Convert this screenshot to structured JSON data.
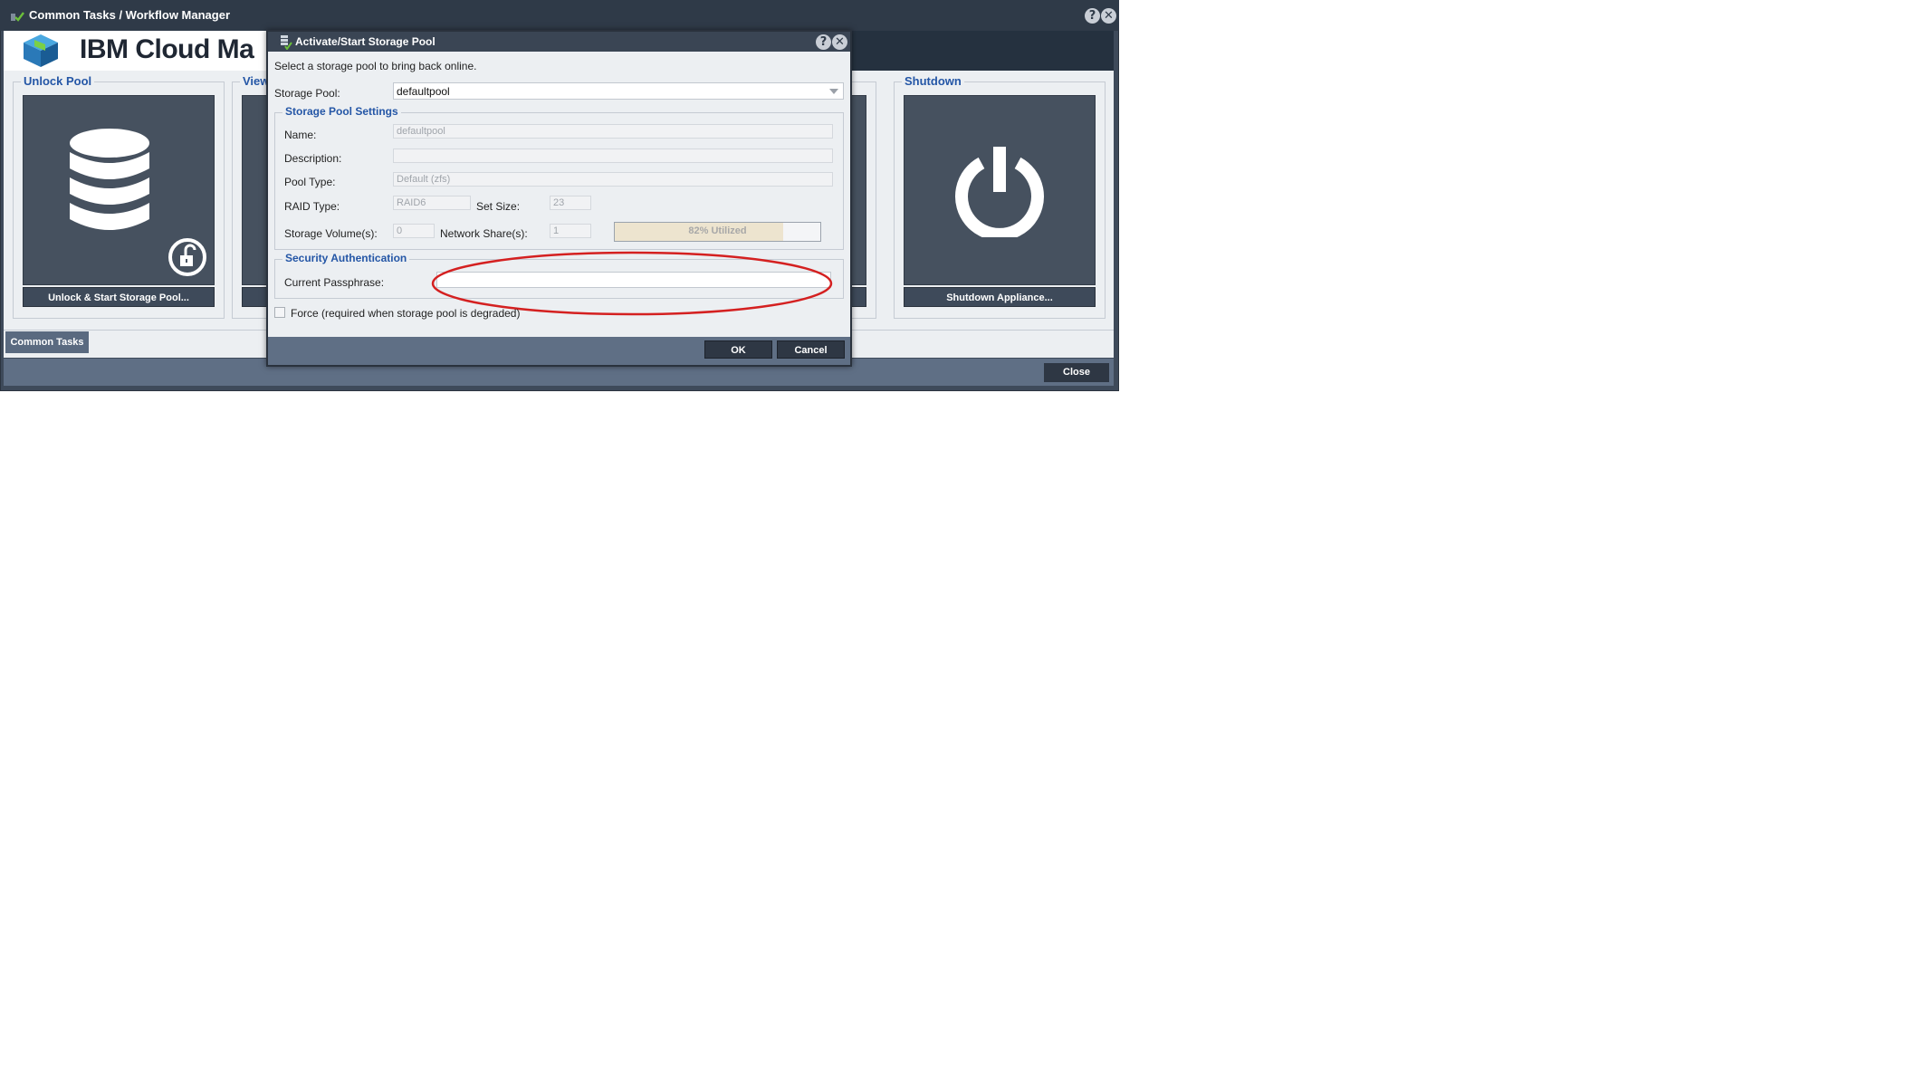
{
  "outer_window": {
    "title": "Common Tasks / Workflow Manager",
    "brand": "IBM Cloud Ma",
    "cards": [
      {
        "title": "Unlock Pool",
        "button": "Unlock & Start Storage Pool..."
      },
      {
        "title": "View",
        "button": ""
      },
      {
        "title": "Shutdown",
        "button": "Shutdown Appliance..."
      }
    ],
    "tabs": [
      {
        "label": "Common Tasks"
      }
    ],
    "close_label": "Close",
    "help_icon": "?",
    "close_icon": "✕"
  },
  "dialog": {
    "title": "Activate/Start Storage Pool",
    "help_icon": "?",
    "close_icon": "✕",
    "instruction": "Select a storage pool to bring back online.",
    "storage_pool_label": "Storage Pool:",
    "storage_pool_value": "defaultpool",
    "settings": {
      "legend": "Storage Pool Settings",
      "name_label": "Name:",
      "name_value": "defaultpool",
      "description_label": "Description:",
      "description_value": "",
      "pool_type_label": "Pool Type:",
      "pool_type_value": "Default (zfs)",
      "raid_type_label": "RAID Type:",
      "raid_type_value": "RAID6",
      "set_size_label": "Set Size:",
      "set_size_value": "23",
      "storage_volumes_label": "Storage Volume(s):",
      "storage_volumes_value": "0",
      "network_shares_label": "Network Share(s):",
      "network_shares_value": "1",
      "utilization_text": "82% Utilized",
      "utilization_fraction": 0.82
    },
    "security": {
      "legend": "Security Authentication",
      "passphrase_label": "Current Passphrase:",
      "passphrase_value": ""
    },
    "force_label": "Force (required when storage pool is degraded)",
    "force_checked": false,
    "ok_label": "OK",
    "cancel_label": "Cancel"
  },
  "colors": {
    "accent_title": "#2456a6",
    "annotation": "#d42020"
  }
}
